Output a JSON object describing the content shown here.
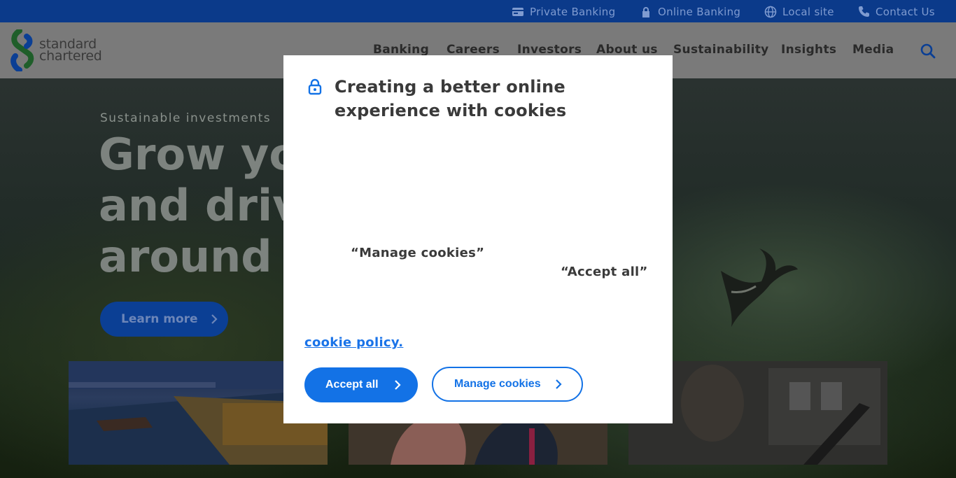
{
  "utility_bar": {
    "items": [
      {
        "label": "Private Banking",
        "icon": "card-icon"
      },
      {
        "label": "Online Banking",
        "icon": "lock-icon"
      },
      {
        "label": "Local site",
        "icon": "globe-icon"
      },
      {
        "label": "Contact Us",
        "icon": "phone-icon"
      }
    ]
  },
  "header": {
    "logo_line1": "standard",
    "logo_line2": "chartered",
    "nav": [
      "Banking",
      "Careers",
      "Investors",
      "About us",
      "Sustainability",
      "Insights",
      "Media"
    ]
  },
  "hero": {
    "kicker": "Sustainable investments",
    "title": "Grow your\nand drive\naround th",
    "cta_label": "Learn more"
  },
  "modal": {
    "title": "Creating a better online experience with cookies",
    "quote_manage": "“Manage cookies”",
    "quote_accept": "“Accept all”",
    "cookie_link": "cookie policy.",
    "accept_label": "Accept all",
    "manage_label": "Manage cookies"
  },
  "colors": {
    "brand_blue": "#1372e6",
    "utility_bar": "#0b3a8a",
    "logo_green": "#38d200"
  }
}
